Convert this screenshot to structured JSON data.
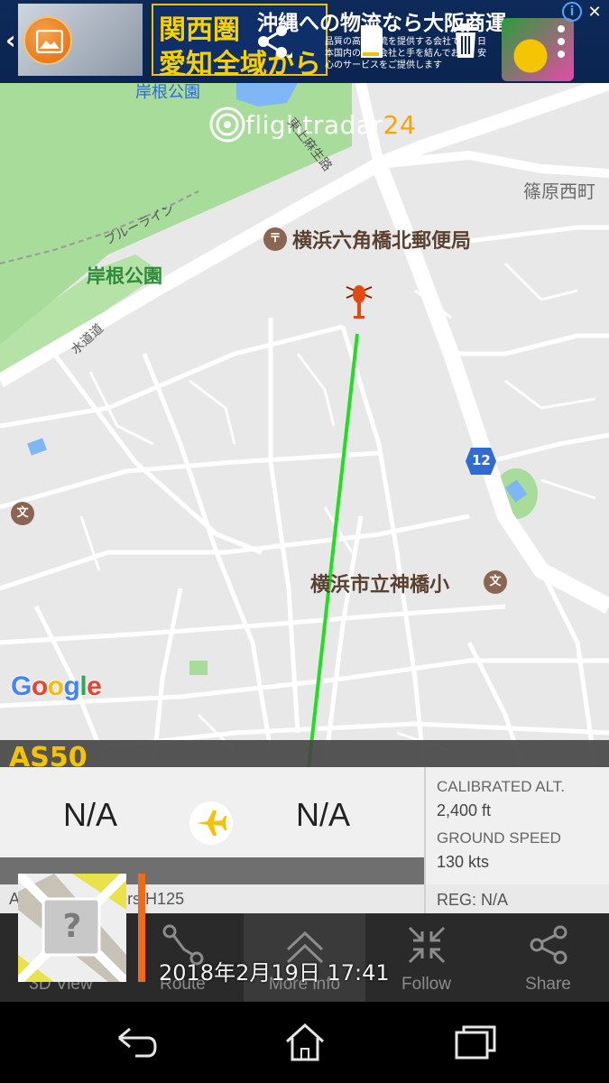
{
  "ad": {
    "headline_line1": "関西圏",
    "headline_line2": "愛知全域から",
    "copy": "沖縄への物流なら大阪商運",
    "subcopy": "品質の高い物流を提供する会社です。日本国内の物流会社と手を結んでおり、安心のサービスをご提供します",
    "close_label": "✕",
    "info_label": "i"
  },
  "toolbar": {
    "back_label": "‹"
  },
  "map": {
    "brand": "flightradar",
    "brand_num": "24",
    "labels": {
      "park_kishine": "岸根公園",
      "post_office": "横浜六角橋北郵便局",
      "school": "横浜市立神橋小",
      "area_shinohara": "篠原西町",
      "road_blueline": "ブルーライン",
      "road_suidou": "水道道",
      "road_kamiasa": "東上麻生路",
      "park_top": "岸根公園"
    },
    "route_number": "12",
    "poi_school_glyph": "文",
    "google": [
      "G",
      "o",
      "o",
      "g",
      "l",
      "e"
    ],
    "google_colors": [
      "#4285F4",
      "#EA4335",
      "#FBBC05",
      "#4285F4",
      "#34A853",
      "#EA4335"
    ]
  },
  "flight": {
    "aircraft_code": "AS50",
    "origin": "N/A",
    "destination": "N/A",
    "calibrated_alt_label": "CALIBRATED ALT.",
    "calibrated_alt_value": "2,400 ft",
    "ground_speed_label": "GROUND SPEED",
    "ground_speed_value": "130 kts",
    "aircraft_type": "Airbus Helicopters H125",
    "registration": "REG: N/A",
    "photo_placeholder": "?",
    "timestamp": "2018年2月19日 17:41"
  },
  "actions": [
    {
      "label": "3D View",
      "icon": "cube-icon"
    },
    {
      "label": "Route",
      "icon": "route-icon"
    },
    {
      "label": "More info",
      "icon": "chevron-up-icon"
    },
    {
      "label": "Follow",
      "icon": "follow-icon"
    },
    {
      "label": "Share",
      "icon": "share-icon"
    }
  ],
  "colors": {
    "accent": "#f7c300",
    "track": "#22dd22",
    "orange": "#f06a1a"
  }
}
